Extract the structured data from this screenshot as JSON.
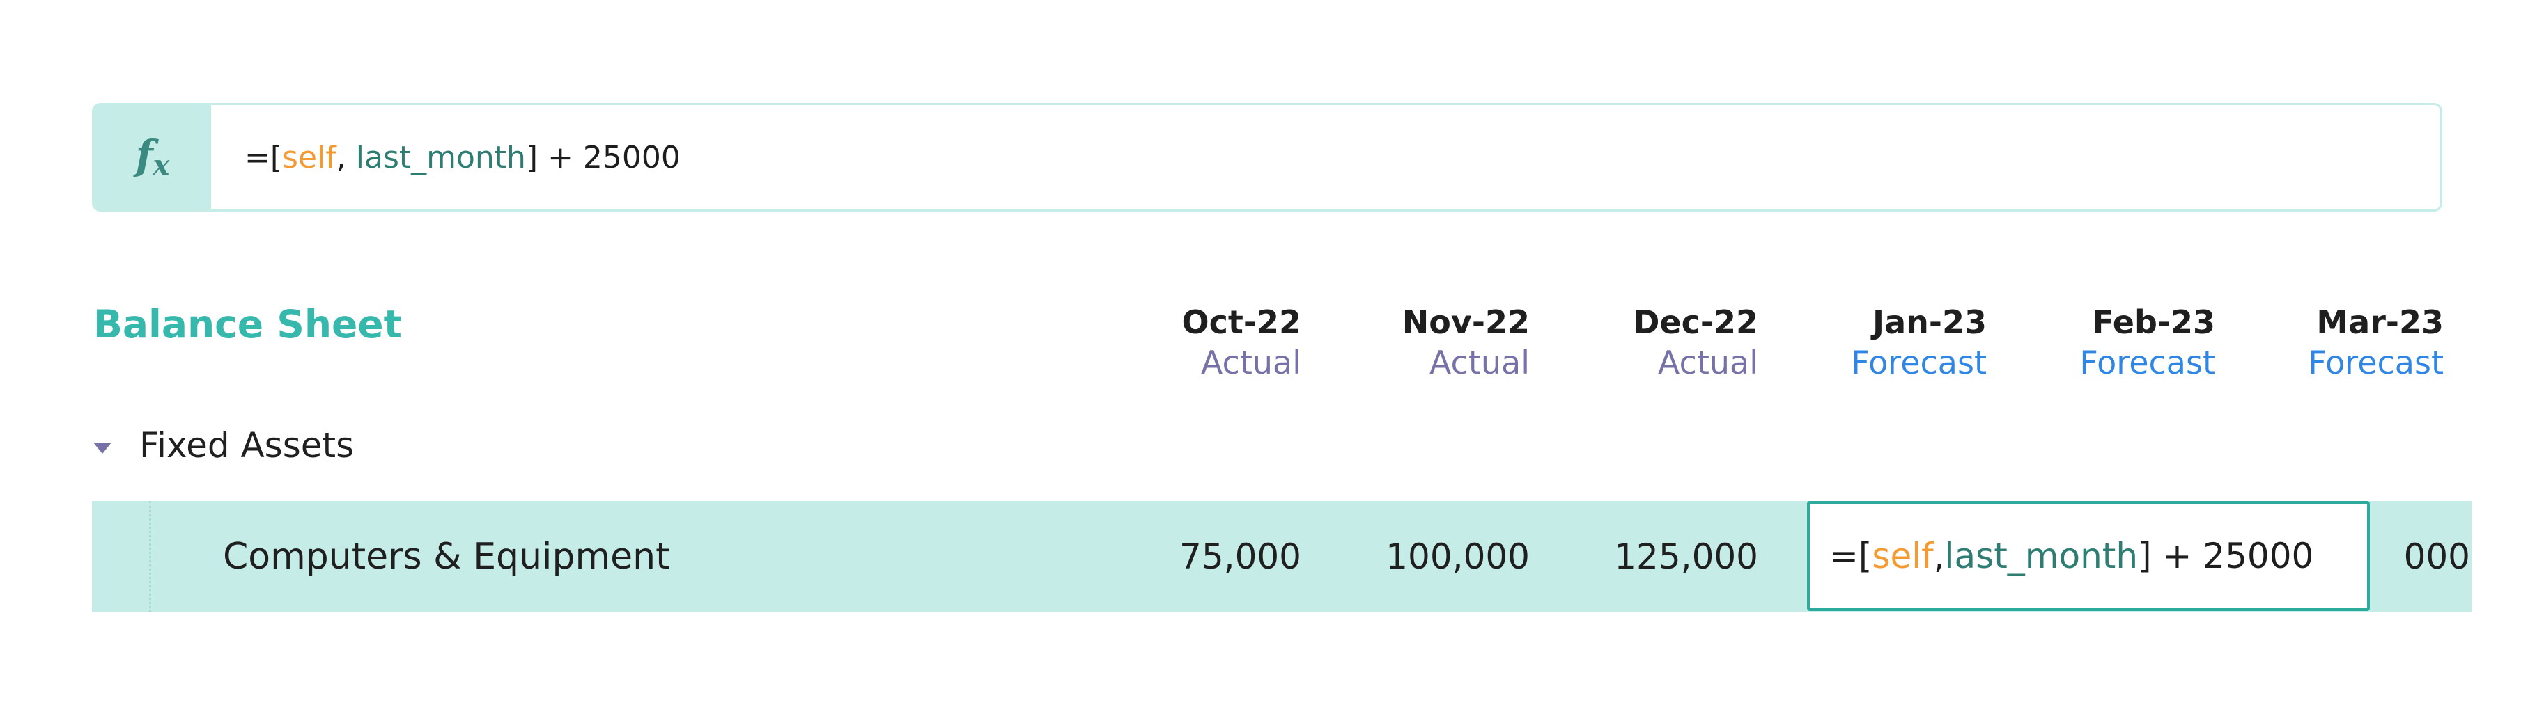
{
  "formula_bar": {
    "fx_icon": "fx-icon",
    "formula": {
      "prefix": "=[",
      "self_token": "self",
      "separator": ", ",
      "ref_token": "last_month",
      "suffix": "] + 25000"
    }
  },
  "sheet": {
    "title": "Balance Sheet",
    "columns": [
      {
        "month": "Oct-22",
        "kind": "Actual"
      },
      {
        "month": "Nov-22",
        "kind": "Actual"
      },
      {
        "month": "Dec-22",
        "kind": "Actual"
      },
      {
        "month": "Jan-23",
        "kind": "Forecast"
      },
      {
        "month": "Feb-23",
        "kind": "Forecast"
      },
      {
        "month": "Mar-23",
        "kind": "Forecast"
      }
    ],
    "groups": [
      {
        "label": "Fixed Assets",
        "rows": [
          {
            "label": "Computers & Equipment",
            "values": [
              "75,000",
              "100,000",
              "125,000",
              "",
              "",
              "000"
            ]
          }
        ]
      }
    ],
    "editor": {
      "prefix": "=[",
      "self_token": "self",
      "separator": ", ",
      "ref_token": "last_month",
      "suffix": "] + 25000"
    }
  },
  "colors": {
    "brand_teal": "#36b8ac",
    "highlight_teal": "#c6ece8",
    "self_token": "#f39a33",
    "ref_token": "#2e7d72",
    "actual": "#7672a8",
    "forecast": "#2f86e4"
  }
}
